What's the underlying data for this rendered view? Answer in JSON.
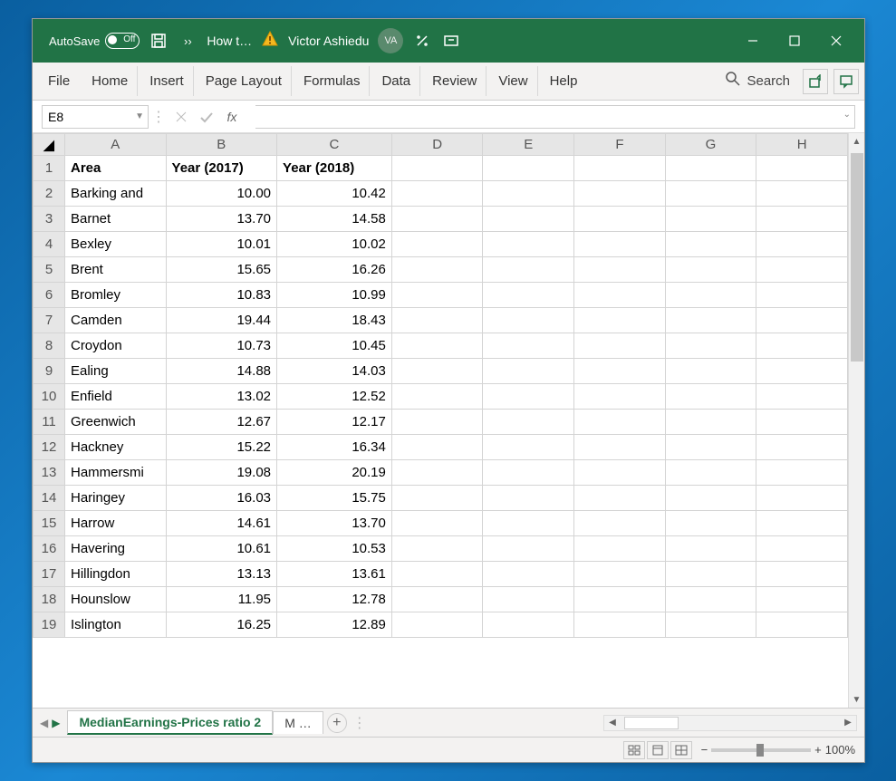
{
  "titlebar": {
    "autosave_label": "AutoSave",
    "autosave_state": "Off",
    "doc_title": "How t…",
    "user_name": "Victor Ashiedu",
    "user_initials": "VA"
  },
  "ribbon": {
    "tabs": [
      "File",
      "Home",
      "Insert",
      "Page Layout",
      "Formulas",
      "Data",
      "Review",
      "View",
      "Help"
    ],
    "search_label": "Search"
  },
  "formula": {
    "namebox": "E8",
    "fx_label": "fx",
    "value": ""
  },
  "grid": {
    "columns": [
      "A",
      "B",
      "C",
      "D",
      "E",
      "F",
      "G",
      "H"
    ],
    "headers": [
      "Area",
      "Year (2017)",
      "Year (2018)"
    ],
    "rows": [
      {
        "n": 1,
        "area": "Area",
        "y17": "Year (2017)",
        "y18": "Year (2018)",
        "bold": true
      },
      {
        "n": 2,
        "area": "Barking and",
        "y17": "10.00",
        "y18": "10.42"
      },
      {
        "n": 3,
        "area": "Barnet",
        "y17": "13.70",
        "y18": "14.58"
      },
      {
        "n": 4,
        "area": "Bexley",
        "y17": "10.01",
        "y18": "10.02"
      },
      {
        "n": 5,
        "area": "Brent",
        "y17": "15.65",
        "y18": "16.26"
      },
      {
        "n": 6,
        "area": "Bromley",
        "y17": "10.83",
        "y18": "10.99"
      },
      {
        "n": 7,
        "area": "Camden",
        "y17": "19.44",
        "y18": "18.43"
      },
      {
        "n": 8,
        "area": "Croydon",
        "y17": "10.73",
        "y18": "10.45"
      },
      {
        "n": 9,
        "area": "Ealing",
        "y17": "14.88",
        "y18": "14.03"
      },
      {
        "n": 10,
        "area": "Enfield",
        "y17": "13.02",
        "y18": "12.52"
      },
      {
        "n": 11,
        "area": "Greenwich",
        "y17": "12.67",
        "y18": "12.17"
      },
      {
        "n": 12,
        "area": "Hackney",
        "y17": "15.22",
        "y18": "16.34"
      },
      {
        "n": 13,
        "area": "Hammersmi",
        "y17": "19.08",
        "y18": "20.19"
      },
      {
        "n": 14,
        "area": "Haringey",
        "y17": "16.03",
        "y18": "15.75"
      },
      {
        "n": 15,
        "area": "Harrow",
        "y17": "14.61",
        "y18": "13.70"
      },
      {
        "n": 16,
        "area": "Havering",
        "y17": "10.61",
        "y18": "10.53"
      },
      {
        "n": 17,
        "area": "Hillingdon",
        "y17": "13.13",
        "y18": "13.61"
      },
      {
        "n": 18,
        "area": "Hounslow",
        "y17": "11.95",
        "y18": "12.78"
      },
      {
        "n": 19,
        "area": "Islington",
        "y17": "16.25",
        "y18": "12.89"
      }
    ]
  },
  "sheets": {
    "active": "MedianEarnings-Prices ratio 2",
    "next": "M …"
  },
  "status": {
    "zoom": "100%"
  }
}
